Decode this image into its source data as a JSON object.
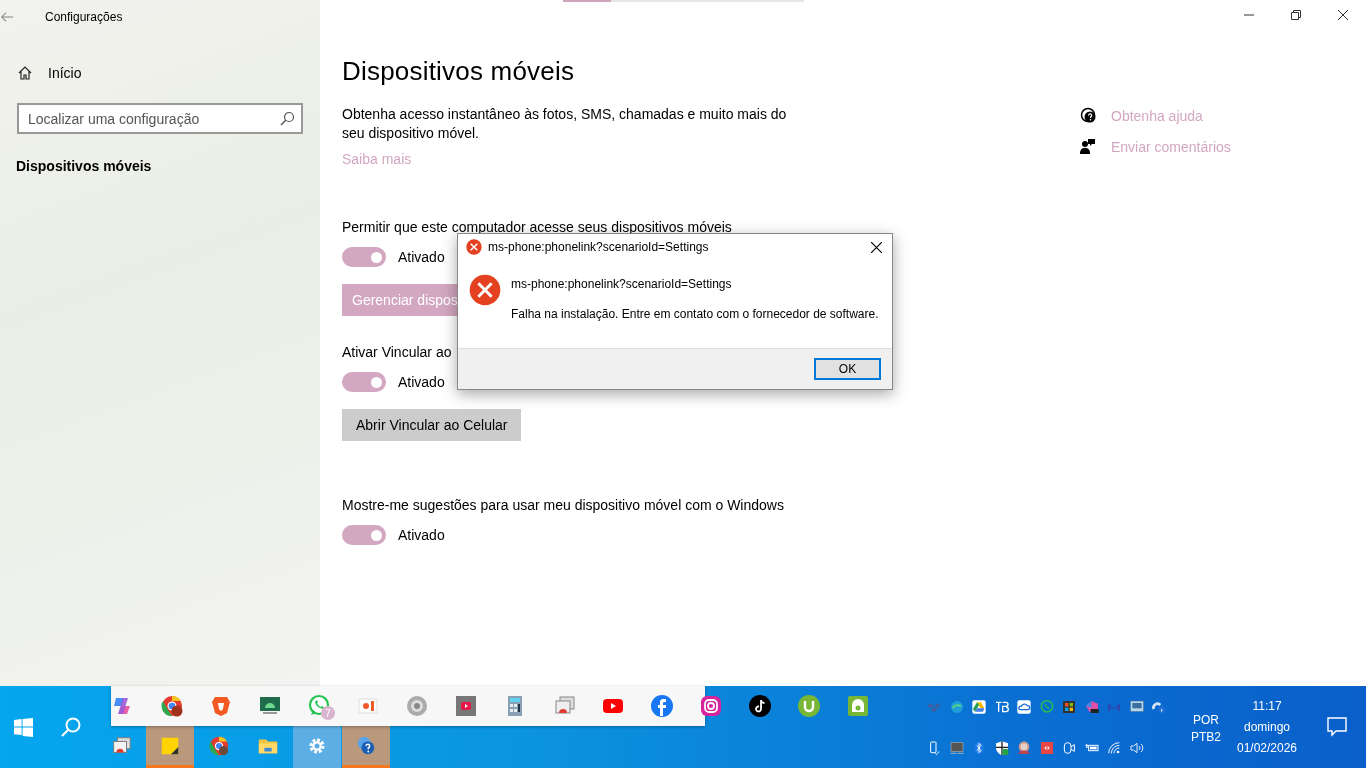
{
  "window": {
    "title": "Configurações",
    "top_bar": {
      "level": 0.2
    }
  },
  "sidebar": {
    "home": "Início",
    "search": {
      "placeholder": "Localizar uma configuração"
    },
    "items": [
      {
        "label": "Dispositivos móveis",
        "selected": true
      }
    ]
  },
  "page": {
    "title": "Dispositivos móveis",
    "description": "Obtenha acesso instantâneo às fotos, SMS, chamadas e muito mais do seu dispositivo móvel.",
    "link": "Saiba mais",
    "sections": [
      {
        "label": "Permitir que este computador acesse seus dispositivos móveis",
        "on": true,
        "state_label": "Ativado",
        "button": {
          "label": "Gerenciar dispos",
          "kind": "accent"
        }
      },
      {
        "label": "Ativar Vincular ao",
        "on": true,
        "state_label": "Ativado",
        "button": {
          "label": "Abrir Vincular ao Celular",
          "kind": "plain"
        }
      },
      {
        "label": "Mostre-me sugestões para usar meu dispositivo móvel com o Windows",
        "on": true,
        "state_label": "Ativado"
      }
    ]
  },
  "help_links": [
    "Obtenha ajuda",
    "Enviar comentários"
  ],
  "dialog": {
    "title": "ms-phone:phonelink?scenarioId=Settings",
    "heading": "ms-phone:phonelink?scenarioId=Settings",
    "message": "Falha na instalação. Entre em contato com o fornecedor de software.",
    "button": "OK"
  },
  "taskbar": {
    "overflow_badge": "7",
    "apps": [
      {
        "selected": false,
        "flashing": false
      },
      {
        "selected": false,
        "flashing": true
      },
      {
        "selected": false,
        "flashing": false
      },
      {
        "selected": false,
        "flashing": false
      },
      {
        "selected": true,
        "flashing": false
      },
      {
        "selected": false,
        "flashing": true
      }
    ],
    "language": [
      "POR",
      "PTB2"
    ],
    "time": "11:17",
    "day": "domingo",
    "date": "01/02/2026"
  }
}
